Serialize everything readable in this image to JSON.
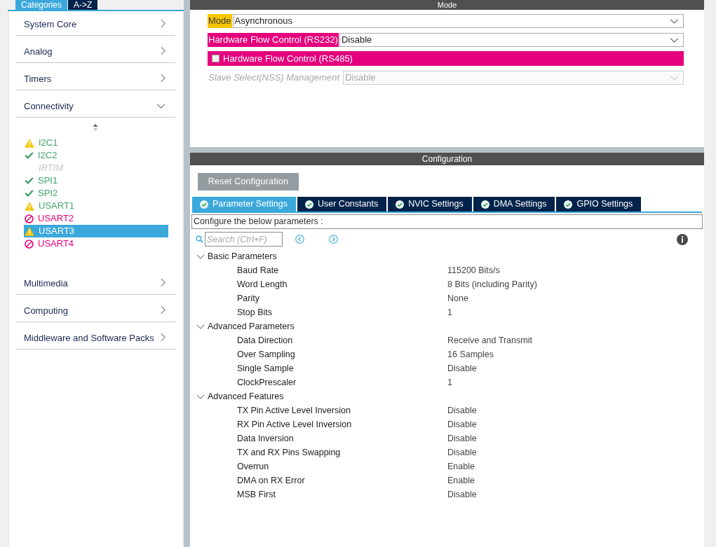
{
  "sidebar": {
    "tabs": [
      {
        "label": "Categories",
        "selected": true
      },
      {
        "label": "A->Z",
        "selected": false
      }
    ],
    "categories": [
      {
        "label": "System Core",
        "expanded": false
      },
      {
        "label": "Analog",
        "expanded": false
      },
      {
        "label": "Timers",
        "expanded": false
      },
      {
        "label": "Connectivity",
        "expanded": true,
        "children": [
          {
            "label": "I2C1",
            "kind": "warning",
            "selected": false
          },
          {
            "label": "I2C2",
            "kind": "ok",
            "selected": false
          },
          {
            "label": "IRTIM",
            "kind": "unavailable",
            "selected": false
          },
          {
            "label": "SPI1",
            "kind": "ok",
            "selected": false
          },
          {
            "label": "SPI2",
            "kind": "ok",
            "selected": false
          },
          {
            "label": "USART1",
            "kind": "warning",
            "selected": false
          },
          {
            "label": "USART2",
            "kind": "error",
            "selected": false
          },
          {
            "label": "USART3",
            "kind": "warning",
            "selected": true
          },
          {
            "label": "USART4",
            "kind": "error",
            "selected": false
          }
        ]
      },
      {
        "label": "Multimedia",
        "expanded": false
      },
      {
        "label": "Computing",
        "expanded": false
      },
      {
        "label": "Middleware and Software Packs",
        "expanded": false
      }
    ]
  },
  "mode_panel": {
    "title": "Mode",
    "fields": [
      {
        "kind": "select",
        "label": "Mode",
        "value": "Asynchronous",
        "color": "#f6c500",
        "disabled": false
      },
      {
        "kind": "select",
        "label": "Hardware Flow Control (RS232)",
        "value": "Disable",
        "color": "#e5007d",
        "disabled": false
      },
      {
        "kind": "checkbox",
        "label": "Hardware Flow Control (RS485)",
        "checked": false,
        "color": "#e5007d",
        "disabled": false
      },
      {
        "kind": "select",
        "label": "Slave Select(NSS) Management",
        "value": "Disable",
        "disabled": true
      }
    ]
  },
  "configuration_panel": {
    "title": "Configuration",
    "reset_button": "Reset Configuration",
    "tabs": [
      {
        "label": "Parameter Settings",
        "selected": true
      },
      {
        "label": "User Constants",
        "selected": false
      },
      {
        "label": "NVIC Settings",
        "selected": false
      },
      {
        "label": "DMA Settings",
        "selected": false
      },
      {
        "label": "GPIO Settings",
        "selected": false
      }
    ],
    "description": "Configure the below parameters :",
    "search": {
      "placeholder": "Search (Ctrl+F)"
    },
    "groups": [
      {
        "label": "Basic Parameters",
        "expanded": true,
        "children": [
          {
            "name": "Baud Rate",
            "value": "115200 Bits/s"
          },
          {
            "name": "Word Length",
            "value": "8 Bits (including Parity)"
          },
          {
            "name": "Parity",
            "value": "None"
          },
          {
            "name": "Stop Bits",
            "value": "1"
          }
        ]
      },
      {
        "label": "Advanced Parameters",
        "expanded": true,
        "children": [
          {
            "name": "Data Direction",
            "value": "Receive and Transmit"
          },
          {
            "name": "Over Sampling",
            "value": "16 Samples"
          },
          {
            "name": "Single Sample",
            "value": "Disable"
          },
          {
            "name": "ClockPrescaler",
            "value": "1"
          }
        ]
      },
      {
        "label": "Advanced Features",
        "expanded": true,
        "children": [
          {
            "name": "TX Pin Active Level Inversion",
            "value": "Disable"
          },
          {
            "name": "RX Pin Active Level Inversion",
            "value": "Disable"
          },
          {
            "name": "Data Inversion",
            "value": "Disable"
          },
          {
            "name": "TX and RX Pins Swapping",
            "value": "Disable"
          },
          {
            "name": "Overrun",
            "value": "Enable"
          },
          {
            "name": "DMA on RX Error",
            "value": "Enable"
          },
          {
            "name": "MSB First",
            "value": "Disable"
          }
        ]
      }
    ]
  }
}
